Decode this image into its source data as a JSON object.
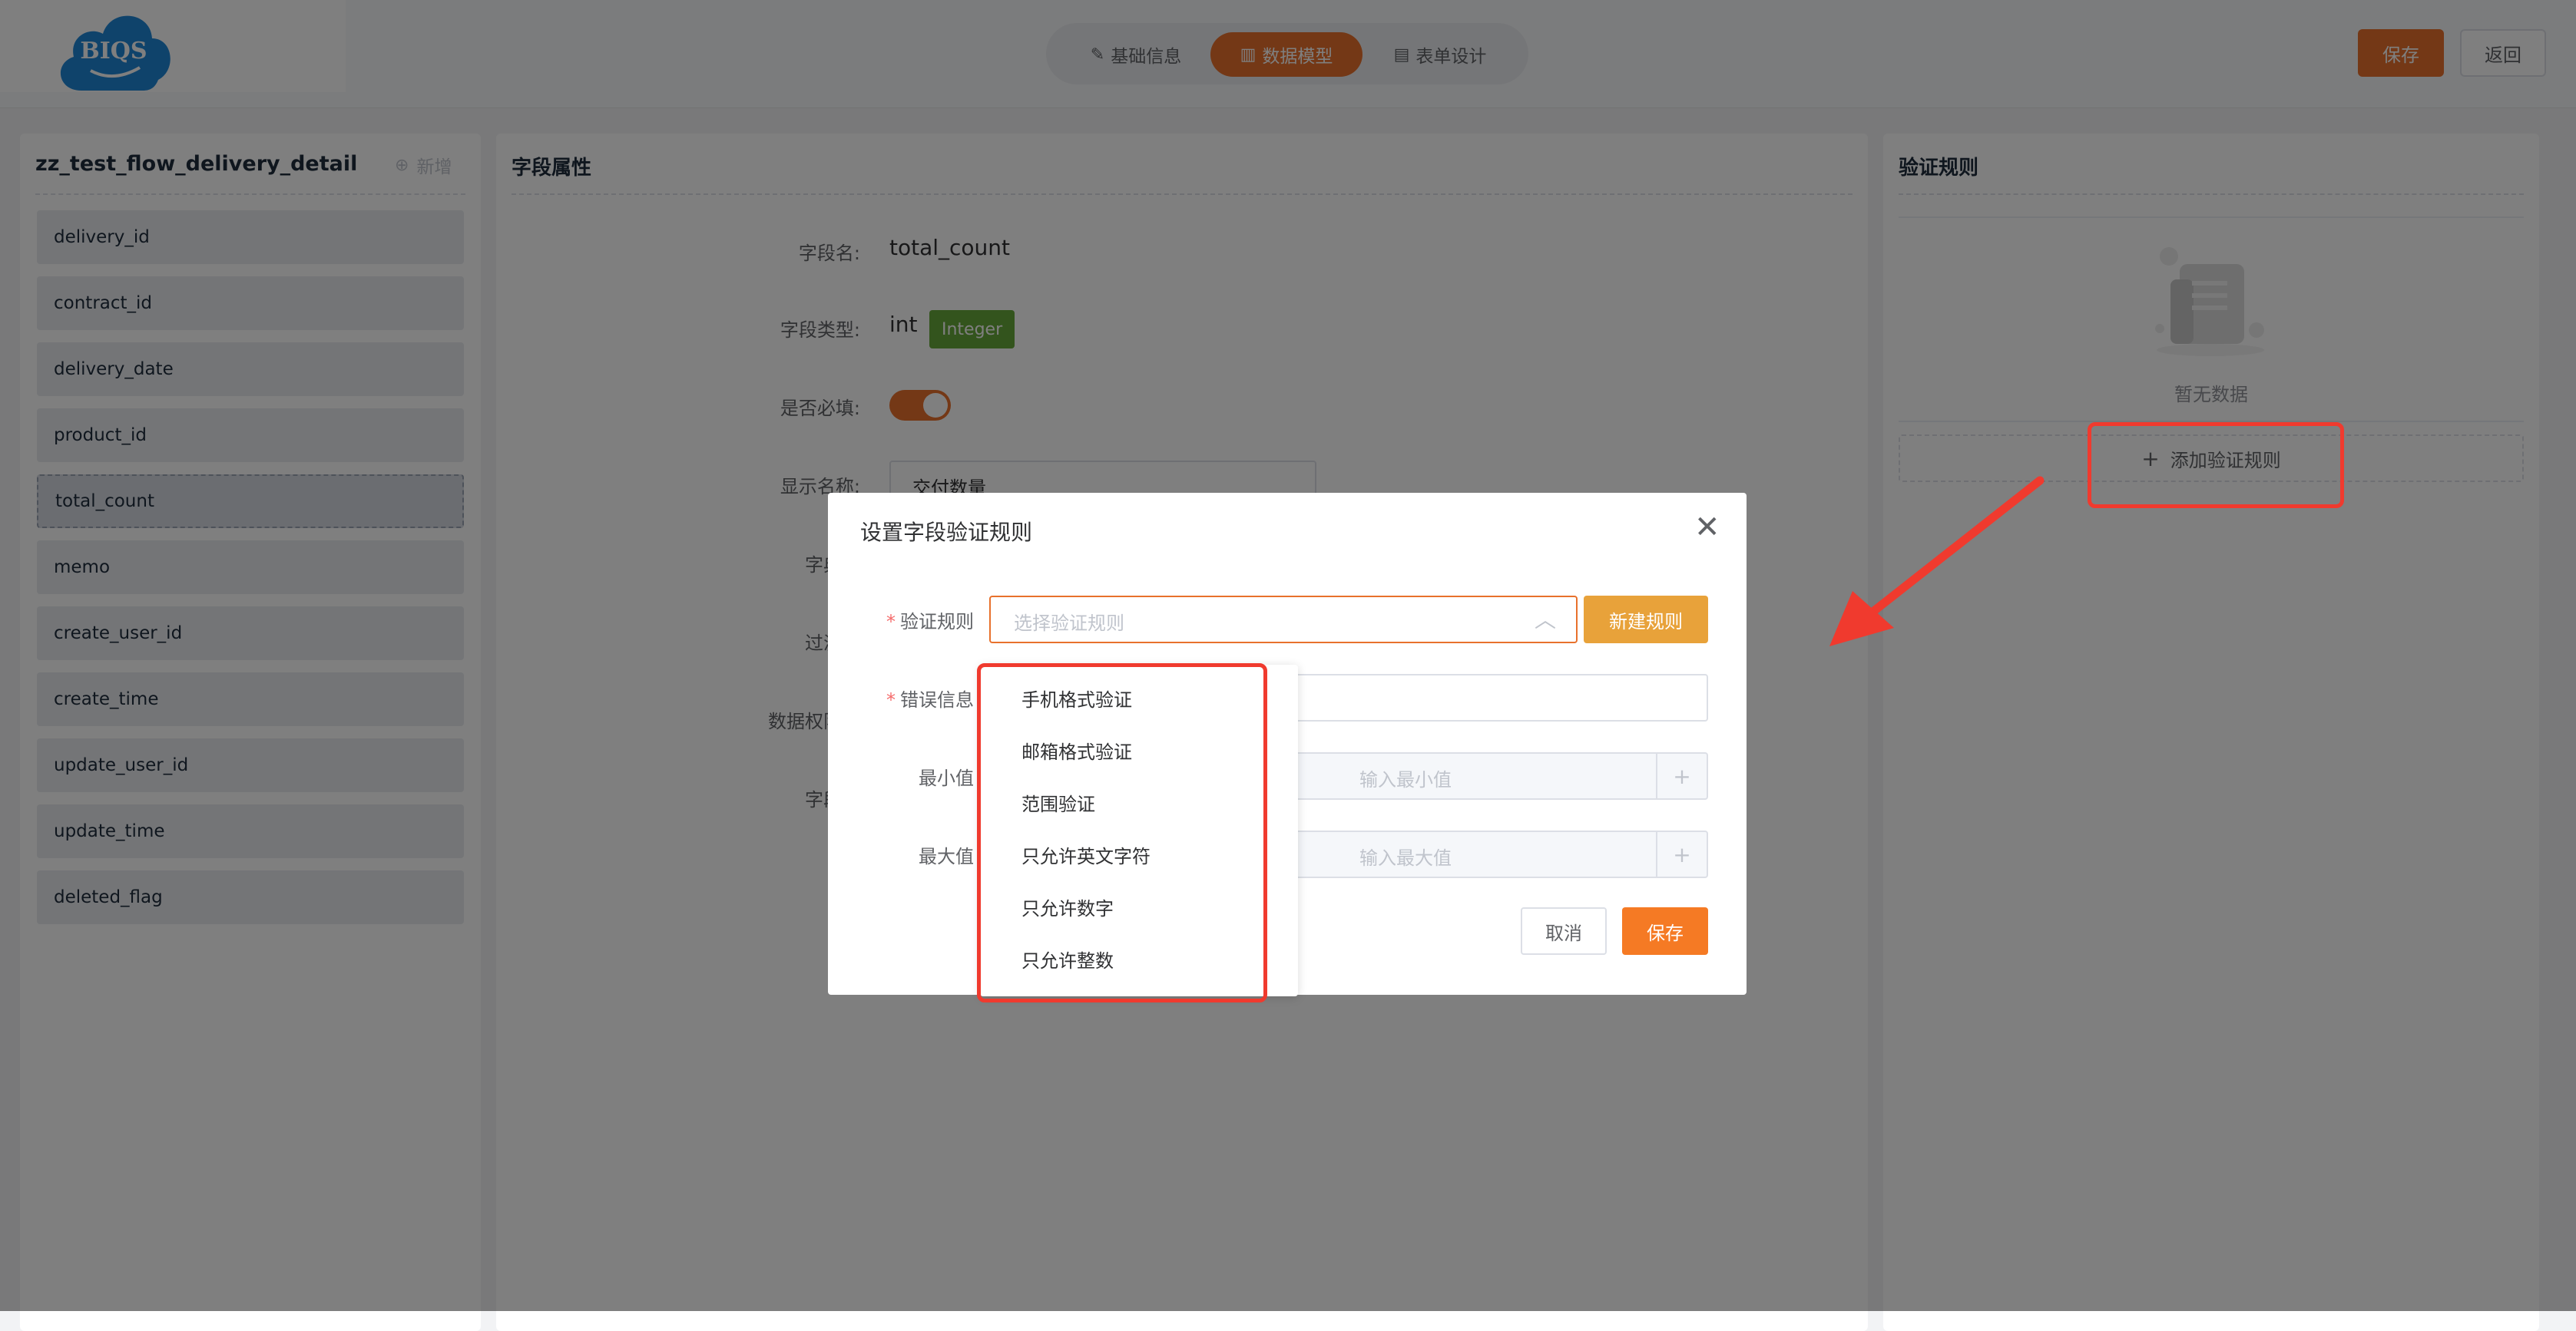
{
  "logo": {
    "text": "BIQS"
  },
  "tabs": [
    {
      "label": "基础信息",
      "icon": "edit-icon"
    },
    {
      "label": "数据模型",
      "icon": "chart-icon"
    },
    {
      "label": "表单设计",
      "icon": "doc-icon"
    }
  ],
  "header": {
    "save_label": "保存",
    "back_label": "返回"
  },
  "left_panel": {
    "title": "zz_test_flow_delivery_detail",
    "add_label": "新增",
    "fields": [
      "delivery_id",
      "contract_id",
      "delivery_date",
      "product_id",
      "total_count",
      "memo",
      "create_user_id",
      "create_time",
      "update_user_id",
      "update_time",
      "deleted_flag"
    ],
    "selected": "total_count"
  },
  "mid_panel": {
    "title": "字段属性",
    "field_name_label": "字段名:",
    "field_name_value": "total_count",
    "field_type_label": "字段类型:",
    "field_type_value": "int",
    "field_type_badge": "Integer",
    "required_label": "是否必填:",
    "required_on": true,
    "display_name_label": "显示名称:",
    "display_name_value": "交付数量",
    "dict_label": "字典数",
    "filter_label": "过滤支",
    "perm_label": "数据权限过",
    "field_kind_label": "字段类"
  },
  "right_panel": {
    "title": "验证规则",
    "empty_text": "暂无数据",
    "add_rule_label": "添加验证规则"
  },
  "dialog": {
    "title": "设置字段验证规则",
    "rule_label": "验证规则",
    "rule_placeholder": "选择验证规则",
    "new_rule_label": "新建规则",
    "error_label": "错误信息",
    "min_label": "最小值",
    "min_placeholder": "输入最小值",
    "max_label": "最大值",
    "max_placeholder": "输入最大值",
    "cancel_label": "取消",
    "save_label": "保存",
    "options": [
      "手机格式验证",
      "邮箱格式验证",
      "范围验证",
      "只允许英文字符",
      "只允许数字",
      "只允许整数"
    ]
  },
  "colors": {
    "accent": "#e8712c",
    "badge": "#67a83a",
    "annotation": "#f03a2e"
  }
}
